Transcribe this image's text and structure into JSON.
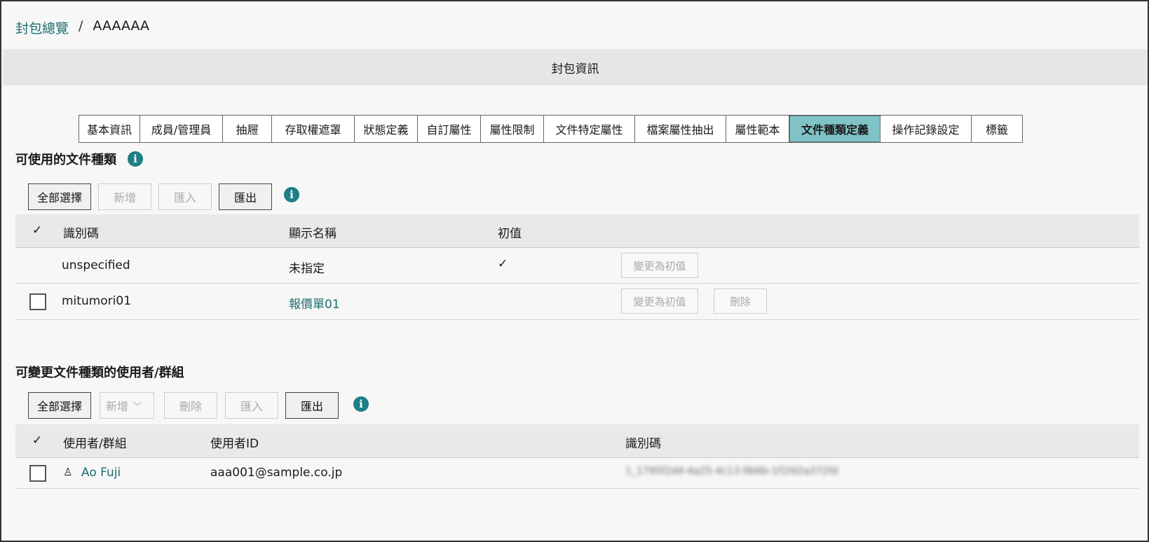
{
  "breadcrumb": {
    "link": "封包總覽",
    "separator": "/",
    "current": "AAAAAA"
  },
  "section_title": "封包資訊",
  "tabs": [
    {
      "label": "基本資訊",
      "w": 87
    },
    {
      "label": "成員/管理員",
      "w": 118
    },
    {
      "label": "抽屜",
      "w": 70
    },
    {
      "label": "存取權遮罩",
      "w": 118
    },
    {
      "label": "狀態定義",
      "w": 90
    },
    {
      "label": "自訂屬性",
      "w": 90
    },
    {
      "label": "屬性限制",
      "w": 90
    },
    {
      "label": "文件特定屬性",
      "w": 130
    },
    {
      "label": "檔案屬性抽出",
      "w": 130
    },
    {
      "label": "屬性範本",
      "w": 90
    },
    {
      "label": "文件種類定義",
      "w": 130
    },
    {
      "label": "操作記錄設定",
      "w": 130
    },
    {
      "label": "標籤",
      "w": 72
    }
  ],
  "active_tab": "文件種類定義",
  "doc_types": {
    "heading": "可使用的文件種類",
    "buttons": {
      "select_all": "全部選擇",
      "add": "新增",
      "import": "匯入",
      "export": "匯出"
    },
    "columns": {
      "check": "✓",
      "id": "識別碼",
      "display_name": "顯示名稱",
      "default": "初值"
    },
    "rows": [
      {
        "id": "unspecified",
        "display_name": "未指定",
        "default_mark": "✓",
        "set_default": "變更為初值"
      },
      {
        "id": "mitumori01",
        "display_name": "報價單01",
        "set_default": "變更為初值",
        "delete": "刪除"
      }
    ]
  },
  "users": {
    "heading": "可變更文件種類的使用者/群組",
    "buttons": {
      "select_all": "全部選擇",
      "add": "新增",
      "delete": "刪除",
      "import": "匯入",
      "export": "匯出"
    },
    "columns": {
      "check": "✓",
      "user_group": "使用者/群組",
      "user_id": "使用者ID",
      "identifier": "識別碼"
    },
    "rows": [
      {
        "name": "Ao Fuji",
        "user_id": "aaa001@sample.co.jp",
        "identifier": "1_1795f2d4-4a25-4c13-9b6b-1f1fd2a372fd"
      }
    ]
  },
  "colors": {
    "accent": "#1e7f86",
    "active_tab": "#7fc3c7",
    "link": "#1e6e6e"
  }
}
